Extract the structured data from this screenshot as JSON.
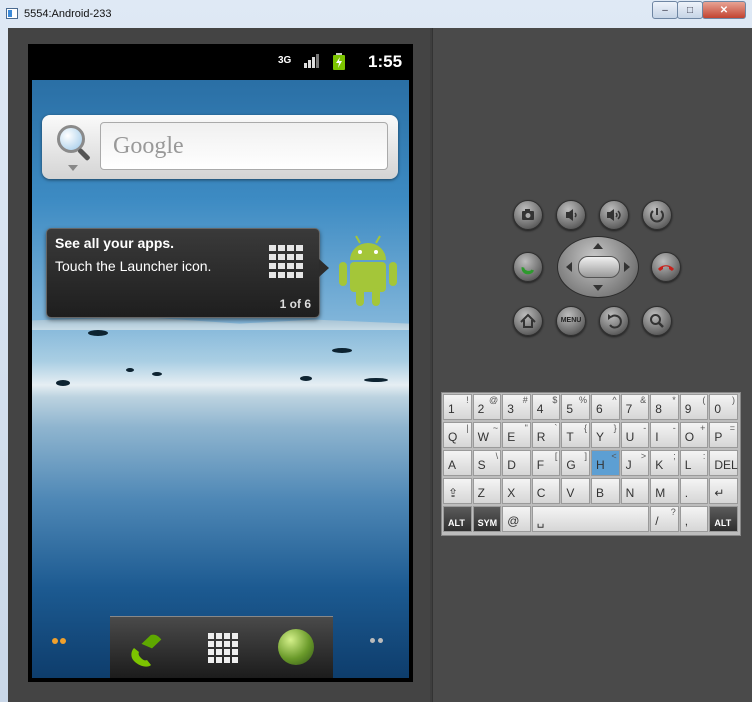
{
  "window": {
    "title": "5554:Android-233",
    "controls": {
      "minimize": "–",
      "maximize": "□",
      "close": "✕"
    }
  },
  "status_bar": {
    "network": "3G",
    "time": "1:55"
  },
  "search_widget": {
    "placeholder": "Google"
  },
  "tooltip": {
    "heading": "See all your apps.",
    "body": "Touch the Launcher icon.",
    "pager": "1 of 6"
  },
  "hw_controls": {
    "menu_label": "MENU"
  },
  "keyboard": {
    "rows": [
      [
        {
          "m": "1",
          "s": "!"
        },
        {
          "m": "2",
          "s": "@"
        },
        {
          "m": "3",
          "s": "#"
        },
        {
          "m": "4",
          "s": "$"
        },
        {
          "m": "5",
          "s": "%"
        },
        {
          "m": "6",
          "s": "^"
        },
        {
          "m": "7",
          "s": "&"
        },
        {
          "m": "8",
          "s": "*"
        },
        {
          "m": "9",
          "s": "("
        },
        {
          "m": "0",
          "s": ")"
        }
      ],
      [
        {
          "m": "Q",
          "s": "|"
        },
        {
          "m": "W",
          "s": "~"
        },
        {
          "m": "E",
          "s": "\""
        },
        {
          "m": "R",
          "s": "`"
        },
        {
          "m": "T",
          "s": "{"
        },
        {
          "m": "Y",
          "s": "}"
        },
        {
          "m": "U",
          "s": "-"
        },
        {
          "m": "I",
          "s": "-"
        },
        {
          "m": "O",
          "s": "+"
        },
        {
          "m": "P",
          "s": "="
        }
      ],
      [
        {
          "m": "A",
          "s": ""
        },
        {
          "m": "S",
          "s": "\\"
        },
        {
          "m": "D",
          "s": ""
        },
        {
          "m": "F",
          "s": "["
        },
        {
          "m": "G",
          "s": "]"
        },
        {
          "m": "H",
          "s": "<"
        },
        {
          "m": "J",
          "s": ">"
        },
        {
          "m": "K",
          "s": ";"
        },
        {
          "m": "L",
          "s": ":"
        },
        {
          "m": "DEL",
          "s": ""
        }
      ],
      [
        {
          "m": "⇪",
          "s": ""
        },
        {
          "m": "Z",
          "s": ""
        },
        {
          "m": "X",
          "s": ""
        },
        {
          "m": "C",
          "s": ""
        },
        {
          "m": "V",
          "s": ""
        },
        {
          "m": "B",
          "s": ""
        },
        {
          "m": "N",
          "s": ""
        },
        {
          "m": "M",
          "s": ""
        },
        {
          "m": ".",
          "s": ""
        },
        {
          "m": "↵",
          "s": ""
        }
      ],
      [
        {
          "m": "ALT",
          "s": ""
        },
        {
          "m": "SYM",
          "s": ""
        },
        {
          "m": "@",
          "s": ""
        },
        {
          "m": "␣",
          "s": ""
        },
        {
          "m": "/",
          "s": "?"
        },
        {
          "m": ",",
          "s": ""
        },
        {
          "m": "ALT",
          "s": ""
        }
      ]
    ]
  },
  "colors": {
    "accent_key": "#5d9fd3",
    "android_green": "#a4c639",
    "battery_green": "#7cc400"
  }
}
